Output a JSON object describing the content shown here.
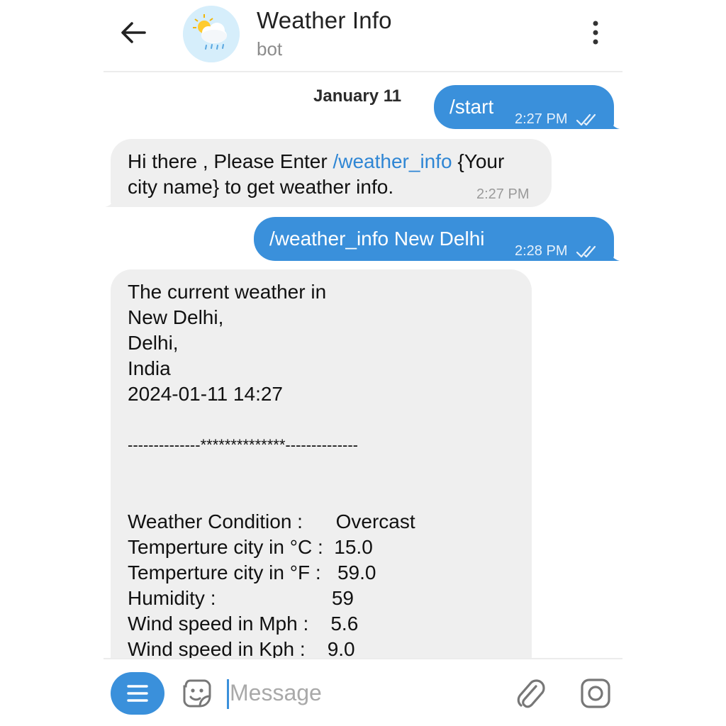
{
  "header": {
    "title": "Weather Info",
    "subtitle": "bot"
  },
  "chat": {
    "date": "January 11",
    "messages": [
      {
        "direction": "out",
        "text": "/start",
        "time": "2:27 PM",
        "status": "read"
      },
      {
        "direction": "in",
        "text_before": "Hi there , Please Enter ",
        "link": "/weather_info",
        "text_after": " {Your",
        "text_line2": "city name} to get weather info.",
        "time": "2:27 PM"
      },
      {
        "direction": "out",
        "text": "/weather_info New Delhi",
        "time": "2:28 PM",
        "status": "read"
      },
      {
        "direction": "in",
        "lines": [
          "The current weather in",
          "New Delhi,",
          "Delhi,",
          "India",
          "2024-01-11 14:27",
          "",
          "--------------**************--------------",
          "",
          "",
          "Weather Condition :      Overcast",
          "Temperture city in °C :  15.0",
          "Temperture city in °F :   59.0",
          "Humidity :                     59",
          "Wind speed in Mph :    5.6",
          "Wind speed in Kph :    9.0"
        ]
      }
    ]
  },
  "input": {
    "placeholder": "Message",
    "value": ""
  },
  "icons": {
    "back": "arrow-left-icon",
    "menu": "more-vertical-icon",
    "bot_menu": "hamburger-icon",
    "sticker": "sticker-icon",
    "attach": "paperclip-icon",
    "camera": "camera-icon"
  },
  "colors": {
    "accent": "#3a90db",
    "incoming_bubble": "#efefef",
    "link": "#2f86d4"
  }
}
